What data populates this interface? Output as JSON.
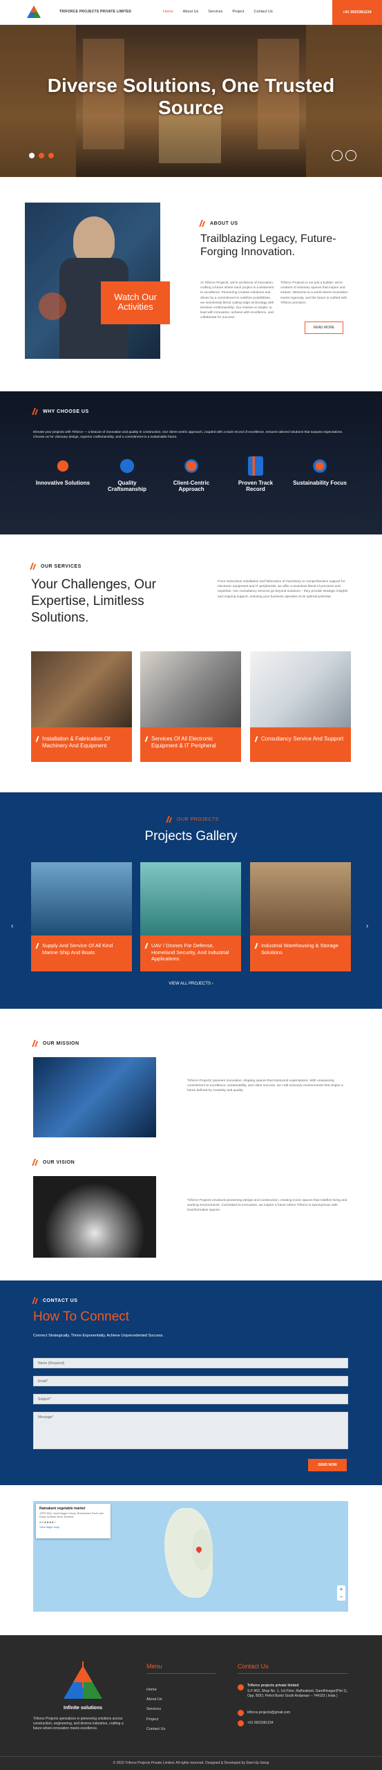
{
  "header": {
    "brand": "TRIFORCE PROJECTS PRIVATE LIMITED",
    "nav": [
      "Home",
      "About Us",
      "Services",
      "Project",
      "Contact Us"
    ],
    "phone": "+91 9923381234"
  },
  "hero": {
    "title": "Diverse Solutions, One Trusted Source"
  },
  "about": {
    "tag": "ABOUT US",
    "heading": "Trailblazing Legacy, Future-Forging Innovation.",
    "badge": "Watch Our Activities",
    "para_left": "At Triforce Projects, we're architects of innovation, crafting a future where each project is a testament to excellence. Pioneering creative solutions and driven by a commitment to redefine possibilities, we seamlessly blend cutting-edge technology with timeless craftsmanship. Our mission is simple: to lead with innovation, achieve with excellence, and collaborate for success.",
    "para_right": "Triforce Projects is not just a builder; we're creators of visionary spaces that inspire and endure. Welcome to a world where innovation meets ingenuity, and the future is crafted with Triforce precision.",
    "read_more": "READ MORE"
  },
  "why": {
    "tag": "WHY CHOOSE US",
    "text": "Elevate your projects with Triforce — a beacon of innovation and quality in construction. Our client-centric approach, coupled with a track record of excellence, ensures tailored solutions that surpass expectations. Choose us for visionary design, superior craftsmanship, and a commitment to a sustainable future.",
    "items": [
      {
        "label": "Innovative Solutions",
        "icon": "lightbulb-icon"
      },
      {
        "label": "Quality Craftsmanship",
        "icon": "badge-icon"
      },
      {
        "label": "Client-Centric Approach",
        "icon": "team-icon"
      },
      {
        "label": "Proven Track Record",
        "icon": "chart-icon"
      },
      {
        "label": "Sustainability Focus",
        "icon": "leaf-icon"
      }
    ]
  },
  "services": {
    "tag": "OUR SERVICES",
    "heading": "Your Challenges, Our Expertise, Limitless Solutions.",
    "text": "From meticulous installation and fabrication of machinery to comprehensive support for electronic equipment and IT peripherals, we offer a seamless blend of precision and expertise. Our consultancy services go beyond solutions – they provide strategic insights and ongoing support, ensuring your business operates at its optimal potential.",
    "cards": [
      {
        "label": "Installation & Fabrication Of Machinery And Equipment"
      },
      {
        "label": "Services Of All Electronic Equipment & IT Peripheral"
      },
      {
        "label": "Consultancy Service And Support"
      }
    ]
  },
  "projects": {
    "tag": "OUR PROJECTS",
    "heading": "Projects Gallery",
    "cards": [
      {
        "label": "Supply And Service Of All Kind Marine Ship And Boats"
      },
      {
        "label": "UAV / Drones For Defense, Homeland Security, And Industrial Applications"
      },
      {
        "label": "Industrial Warehousing & Storage Solutions"
      }
    ],
    "view_all": "VIEW ALL PROJECTS"
  },
  "mission": {
    "tag": "OUR MISSION",
    "text": "Triforce Projects' pioneers innovation, shaping spaces that transcend expectations. With unwavering commitment to excellence, sustainability, and client success, we craft visionary environments that inspire a future defined by creativity and quality."
  },
  "vision": {
    "tag": "OUR VISION",
    "text": "Triforce Projects envisions pioneering design and construction, creating iconic spaces that redefine living and working environments. Committed to innovation, we inspire a future where Triforce is synonymous with transformative spaces."
  },
  "contact": {
    "tag": "CONTACT US",
    "heading": "How To Connect",
    "sub": "Connect Strategically, Thrive Exponentially, Achieve Unprecedented Success.",
    "placeholders": {
      "name": "Name (Required)",
      "email": "Email*",
      "subject": "Subject*",
      "message": "Message*"
    },
    "send": "SEND NOW"
  },
  "map": {
    "place_name": "Ratnakant vegetable market",
    "place_addr": "J2PP+8QJ, Azad Nagar Colony, Bhuleshwar Parit Lane Road, Andheri West, Mumbai",
    "rating": "4.0",
    "larger": "View larger map"
  },
  "footer": {
    "logo_text": "Infinite solutions",
    "about": "Triforce Projects specializes in pioneering solutions across construction, engineering, and diverse industries, crafting a future where innovation meets excellence.",
    "menu_title": "Menu",
    "menu": [
      "Home",
      "About Us",
      "Services",
      "Project",
      "Contact Us"
    ],
    "contact_title": "Contact Us",
    "company": "Triforce projects private limited",
    "address": "S.F-963, Shop No. 1, 1st Floor, Rathnakant, Gandhinagar(Plot 1), Opp. BDO, Petrol Bunk/ South Andaman – 744103 ( India )",
    "email": "triforce.projects@gmail.com",
    "phone": "+91 9923381234",
    "copyright": "© 2023 Triforce Projects Private Limited. All rights reserved. Designed & Developed by Start-Up Setup"
  },
  "colors": {
    "accent": "#f15a22",
    "navy": "#0d3b73",
    "dark": "#2b2b2b"
  }
}
